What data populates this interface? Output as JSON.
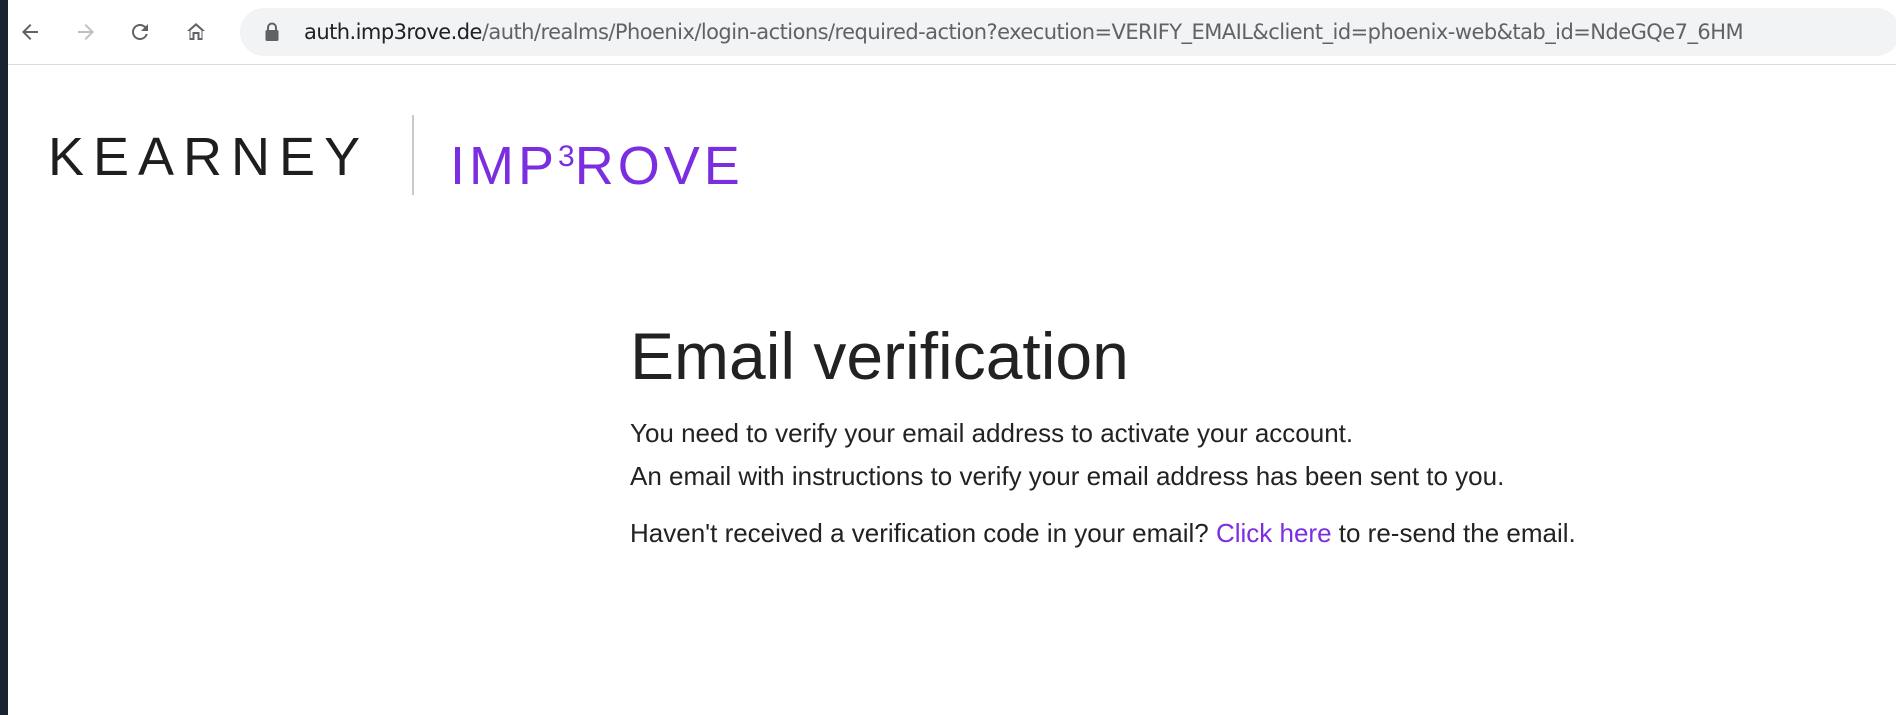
{
  "browser": {
    "url_host": "auth.imp3rove.de",
    "url_path": "/auth/realms/Phoenix/login-actions/required-action?execution=VERIFY_EMAIL&client_id=phoenix-web&tab_id=NdeGQe7_6HM",
    "icons": {
      "back": "back-arrow-icon",
      "forward": "forward-arrow-icon",
      "reload": "reload-icon",
      "home": "home-icon",
      "lock": "lock-icon"
    }
  },
  "header": {
    "brand_primary": "KEARNEY",
    "brand_secondary_prefix": "IMP",
    "brand_secondary_sup": "3",
    "brand_secondary_suffix": "ROVE",
    "brand_accent_color": "#7b2ee0"
  },
  "main": {
    "title": "Email verification",
    "line1": "You need to verify your email address to activate your account.",
    "line2": "An email with instructions to verify your email address has been sent to you.",
    "resend_prefix": "Haven't received a verification code in your email?",
    "resend_link": "Click here",
    "resend_suffix": "to re-send the email."
  }
}
